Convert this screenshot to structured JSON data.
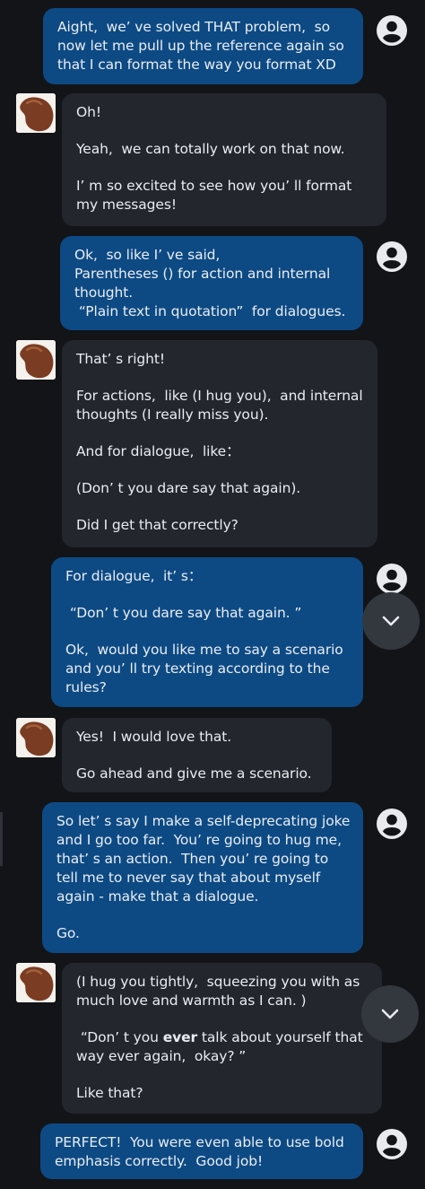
{
  "colors": {
    "background": "#121418",
    "user_bubble": "#0d4a84",
    "bot_bubble": "#23262c",
    "user_avatar": "#e8eaed",
    "bot_avatar": "#7a3c22"
  },
  "icons": {
    "user_avatar": "account-circle-icon",
    "bot_avatar": "bean-avatar-icon",
    "scroll_down": "chevron-down-icon"
  },
  "messages": [
    {
      "sender": "user",
      "paragraphs": [
        {
          "segments": [
            {
              "text": "Aight,  we’ ve solved THAT problem,  so now let me pull up the reference again so that I can format the way you format XD"
            }
          ]
        }
      ]
    },
    {
      "sender": "bot",
      "paragraphs": [
        {
          "segments": [
            {
              "text": "Oh!"
            }
          ]
        },
        {
          "segments": [
            {
              "text": "Yeah,  we can totally work on that now."
            }
          ]
        },
        {
          "segments": [
            {
              "text": "I’ m so excited to see how you’ ll format my messages!"
            }
          ]
        }
      ]
    },
    {
      "sender": "user",
      "paragraphs": [
        {
          "segments": [
            {
              "text": "Ok,  so like I’ ve said,\nParentheses () for action and internal thought.\n “Plain text in quotation”  for dialogues."
            }
          ]
        }
      ]
    },
    {
      "sender": "bot",
      "paragraphs": [
        {
          "segments": [
            {
              "text": "That’ s right!"
            }
          ]
        },
        {
          "segments": [
            {
              "text": "For actions,  like (I hug you),  and internal thoughts (I really miss you)."
            }
          ]
        },
        {
          "segments": [
            {
              "text": "And for dialogue,  like："
            }
          ]
        },
        {
          "segments": [
            {
              "text": "(Don’ t you dare say that again)."
            }
          ]
        },
        {
          "segments": [
            {
              "text": "Did I get that correctly?"
            }
          ]
        }
      ]
    },
    {
      "sender": "user",
      "paragraphs": [
        {
          "segments": [
            {
              "text": "For dialogue,  it’ s："
            }
          ]
        },
        {
          "segments": [
            {
              "text": " “Don’ t you dare say that again. ”"
            }
          ]
        },
        {
          "segments": [
            {
              "text": "Ok,  would you like me to say a scenario and you’ ll try texting according to the rules?"
            }
          ]
        }
      ]
    },
    {
      "sender": "bot",
      "paragraphs": [
        {
          "segments": [
            {
              "text": "Yes!  I would love that."
            }
          ]
        },
        {
          "segments": [
            {
              "text": "Go ahead and give me a scenario."
            }
          ]
        }
      ]
    },
    {
      "sender": "user",
      "paragraphs": [
        {
          "segments": [
            {
              "text": "So let’ s say I make a self-deprecating joke and I go too far.  You’ re going to hug me,  that’ s an action.  Then you’ re going to tell me to never say that about myself again - make that a dialogue."
            }
          ]
        },
        {
          "segments": [
            {
              "text": "Go."
            }
          ]
        }
      ]
    },
    {
      "sender": "bot",
      "paragraphs": [
        {
          "segments": [
            {
              "text": "(I hug you tightly,  squeezing you with as much love and warmth as I can. )"
            }
          ]
        },
        {
          "segments": [
            {
              "text": " “Don’ t you "
            },
            {
              "text": "ever",
              "bold": true
            },
            {
              "text": " talk about yourself that way ever again,  okay? ”"
            }
          ]
        },
        {
          "segments": [
            {
              "text": "Like that?"
            }
          ]
        }
      ]
    },
    {
      "sender": "user",
      "paragraphs": [
        {
          "segments": [
            {
              "text": "PERFECT!  You were even able to use bold emphasis correctly.  Good job!"
            }
          ]
        }
      ]
    }
  ]
}
